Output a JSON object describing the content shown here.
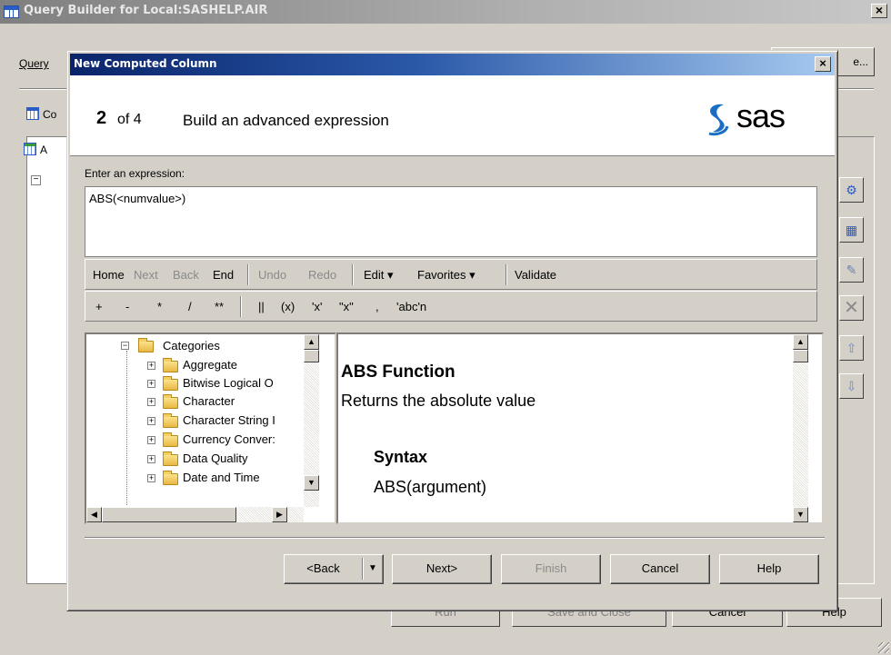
{
  "background_window": {
    "title": "Query Builder for Local:SASHELP.AIR",
    "close_symbol": "×",
    "menu_query": "Query",
    "top_right_button": "e...",
    "computed_label": "Co",
    "panel_label": "A",
    "tree_toggle": "−",
    "side_buttons": [
      "run-query-icon",
      "table-icon",
      "edit-icon",
      "delete-icon",
      "move-up-icon",
      "move-down-icon"
    ],
    "bottom_buttons": {
      "run": "Run",
      "save_and_close": "Save and Close",
      "cancel": "Cancel",
      "help": "Help"
    }
  },
  "dialog": {
    "title": "New Computed Column",
    "close_symbol": "×",
    "step_number": "2",
    "step_of": "of 4",
    "step_title": "Build an advanced expression",
    "logo_text": "sas",
    "expression_label": "Enter an expression:",
    "expression_value": "ABS(<numvalue>)",
    "toolbar1": {
      "home": "Home",
      "next": "Next",
      "back": "Back",
      "end": "End",
      "undo": "Undo",
      "redo": "Redo",
      "edit": "Edit ▾",
      "favorites": "Favorites ▾",
      "validate": "Validate"
    },
    "operators": [
      "+",
      "-",
      "*",
      "/",
      "**",
      "||",
      "(x)",
      "'x'",
      "\"x\"",
      ",",
      "'abc'n"
    ],
    "tree": {
      "root": "Categories",
      "items": [
        "Aggregate",
        "Bitwise Logical O",
        "Character",
        "Character String I",
        "Currency Conver:",
        "Data Quality",
        "Date and Time"
      ]
    },
    "help": {
      "title": "ABS Function",
      "description": "Returns the absolute value",
      "syntax_heading": "Syntax",
      "syntax": "ABS(argument)"
    },
    "buttons": {
      "back": "<Back",
      "next": "Next>",
      "finish": "Finish",
      "cancel": "Cancel",
      "help": "Help"
    }
  },
  "colors": {
    "titlebar_active_start": "#0a246a",
    "titlebar_active_end": "#a6caf0",
    "window_face": "#d4d0c8",
    "disabled_text": "#8a8a8a"
  }
}
